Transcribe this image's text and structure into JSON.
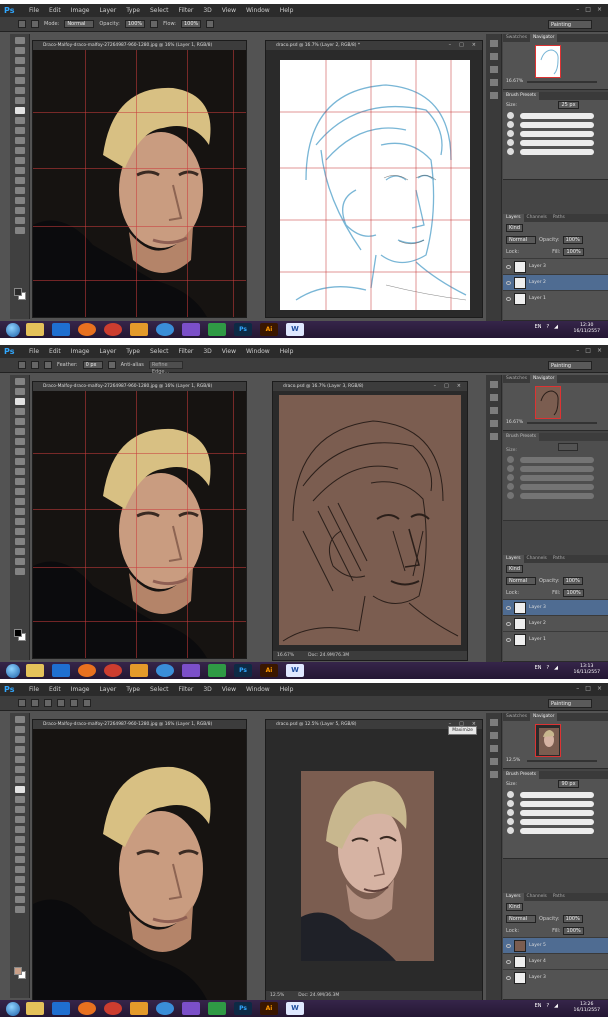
{
  "app": "Ps",
  "menu": [
    "File",
    "Edit",
    "Image",
    "Layer",
    "Type",
    "Select",
    "Filter",
    "3D",
    "View",
    "Window",
    "Help"
  ],
  "window_controls": [
    "–",
    "□",
    "×"
  ],
  "workspace": "Painting",
  "taskbar": {
    "apps": [
      "Ps",
      "Ai",
      "W"
    ],
    "lang": "EN",
    "date": "16/11/2557",
    "times": [
      "12:30",
      "13:13",
      "13:26"
    ]
  },
  "screens": [
    {
      "options": {
        "mode_label": "Mode:",
        "mode": "Normal",
        "opacity_label": "Opacity:",
        "opacity": "100%",
        "flow_label": "Flow:",
        "flow": "100%"
      },
      "ref_tab": "Draco-Malfoy-draco-malfoy-27264987-960-1280.jpg @ 16% (Layer 1, RGB/8)",
      "work_tab": "draco.psd @ 16.7% (Layer 2, RGB/8) *",
      "nav_tabs": [
        "Swatches",
        "Navigator"
      ],
      "nav_zoom": "16.67%",
      "brush_tab": "Brush Presets",
      "size_label": "Size:",
      "size": "25 px",
      "layer_tabs": [
        "Layers",
        "Channels",
        "Paths"
      ],
      "kind": "Kind",
      "blend": "Normal",
      "opacity_label": "Opacity:",
      "opacity": "100%",
      "lock_label": "Lock:",
      "fill_label": "Fill:",
      "fill": "100%",
      "layers": [
        "Layer 3",
        "Layer 2",
        "Layer 1"
      ],
      "selected_layer": 1,
      "status": []
    },
    {
      "options": {
        "feather_label": "Feather:",
        "feather": "0 px",
        "antialias": "Anti-alias",
        "refine": "Refine Edge..."
      },
      "ref_tab": "Draco-Malfoy-draco-malfoy-27264987-960-1280.jpg @ 16% (Layer 1, RGB/8)",
      "work_tab": "draco.psd @ 16.7% (Layer 3, RGB/8)",
      "nav_tabs": [
        "Swatches",
        "Navigator"
      ],
      "nav_zoom": "16.67%",
      "brush_tab": "Brush Presets",
      "size_label": "Size:",
      "size": "",
      "layer_tabs": [
        "Layers",
        "Channels",
        "Paths"
      ],
      "kind": "Kind",
      "blend": "Normal",
      "opacity_label": "Opacity:",
      "opacity": "100%",
      "lock_label": "Lock:",
      "fill_label": "Fill:",
      "fill": "100%",
      "layers": [
        "Layer 3",
        "Layer 2",
        "Layer 1"
      ],
      "selected_layer": 0,
      "status": [
        "16.67%",
        "Doc: 24.9M/76.3M"
      ]
    },
    {
      "options": {},
      "ref_tab": "Draco-Malfoy-draco-malfoy-27264987-960-1280.jpg @ 16% (Layer 1, RGB/8)",
      "work_tab": "draco.psd @ 12.5% (Layer 5, RGB/8)",
      "tooltip": "Maximize",
      "nav_tabs": [
        "Swatches",
        "Navigator"
      ],
      "nav_zoom": "12.5%",
      "brush_tab": "Brush Presets",
      "size_label": "Size:",
      "size": "90 px",
      "layer_tabs": [
        "Layers",
        "Channels",
        "Paths"
      ],
      "kind": "Kind",
      "blend": "Normal",
      "opacity_label": "Opacity:",
      "opacity": "100%",
      "lock_label": "Lock:",
      "fill_label": "Fill:",
      "fill": "100%",
      "layers": [
        "Layer 5",
        "Layer 4",
        "Layer 3"
      ],
      "selected_layer": 0,
      "status": [
        "12.5%",
        "Doc: 24.9M/36.3M"
      ]
    }
  ]
}
